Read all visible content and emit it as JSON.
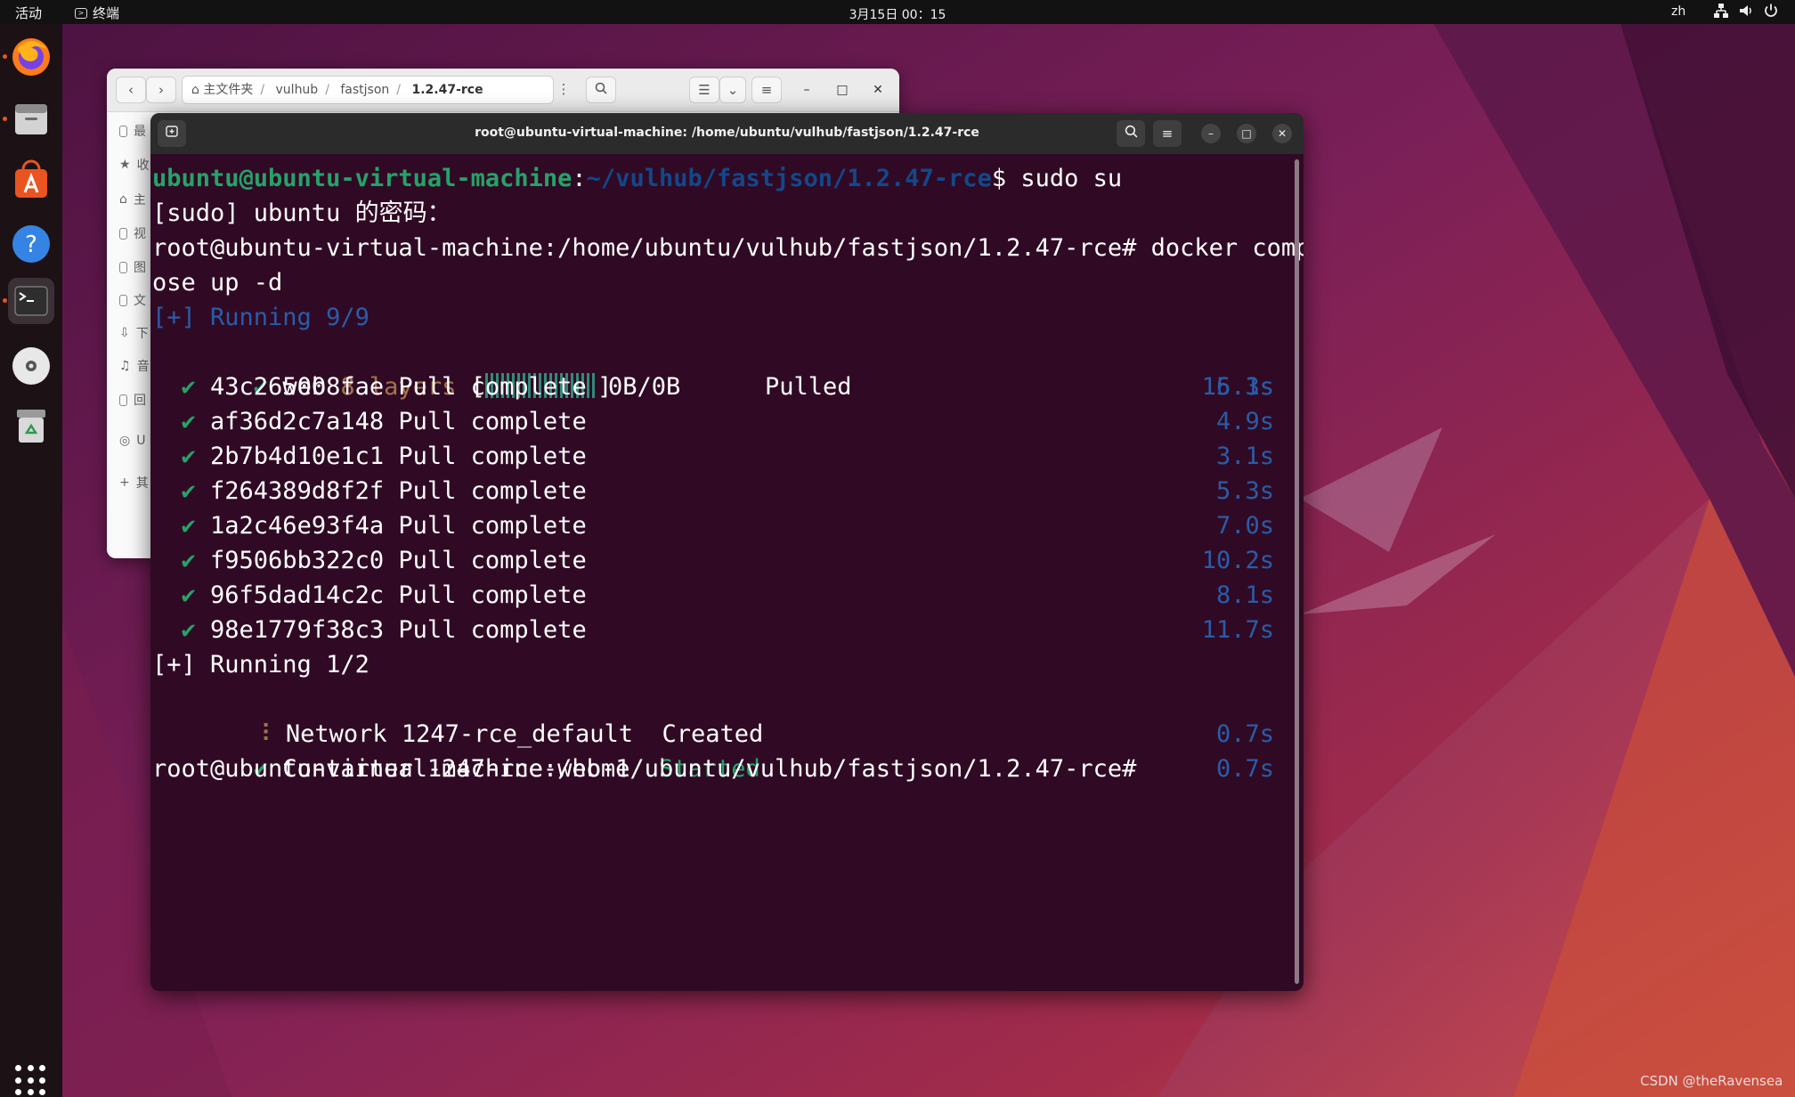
{
  "topbar": {
    "activities": "活动",
    "app_indicator": "终端",
    "clock": "3月15日  00：15",
    "lang": "zh"
  },
  "file_manager": {
    "path_home": "主文件夹",
    "path_1": "vulhub",
    "path_2": "fastjson",
    "path_3": "1.2.47-rce",
    "sidebar": [
      "最",
      "收",
      "主",
      "视",
      "图",
      "文",
      "下",
      "音",
      "回",
      "U",
      "其"
    ]
  },
  "terminal": {
    "title": "root@ubuntu-virtual-machine: /home/ubuntu/vulhub/fastjson/1.2.47-rce",
    "prompt_user": "ubuntu@ubuntu-virtual-machine",
    "prompt_colon": ":",
    "prompt_path": "~/vulhub/fastjson/1.2.47-rce",
    "prompt_cmd": "$ sudo su",
    "line_sudo": "[sudo] ubuntu 的密码：",
    "line_root_cmd": "root@ubuntu-virtual-machine:/home/ubuntu/vulhub/fastjson/1.2.47-rce# docker comp",
    "line_wrap": "ose up -d",
    "running_1": "[+] Running 9/9",
    "web_check": " ✔ ",
    "web_name": "web",
    "web_layers": " 8 layers ",
    "web_bracket_open": "[",
    "web_bracket_close": "]",
    "web_size": "0B/0B",
    "web_status": "Pulled",
    "web_time": "16.3s",
    "layers": [
      {
        "id": "43c265008fae",
        "status": "Pull complete",
        "time": "5.1s"
      },
      {
        "id": "af36d2c7a148",
        "status": "Pull complete",
        "time": "4.9s"
      },
      {
        "id": "2b7b4d10e1c1",
        "status": "Pull complete",
        "time": "3.1s"
      },
      {
        "id": "f264389d8f2f",
        "status": "Pull complete",
        "time": "5.3s"
      },
      {
        "id": "1a2c46e93f4a",
        "status": "Pull complete",
        "time": "7.0s"
      },
      {
        "id": "f9506bb322c0",
        "status": "Pull complete",
        "time": "10.2s"
      },
      {
        "id": "96f5dad14c2c",
        "status": "Pull complete",
        "time": "8.1s"
      },
      {
        "id": "98e1779f38c3",
        "status": "Pull complete",
        "time": "11.7s"
      }
    ],
    "running_2": "[+] Running 1/2",
    "network_mark": " ⠸ ",
    "network_name": "Network 1247-rce_default  ",
    "network_status": "Created",
    "network_time": "0.7s",
    "container_mark": " ✔ ",
    "container_name": "Container 1247-rce-web-1  ",
    "container_status": "Started",
    "container_time": "0.7s",
    "final_prompt": "root@ubuntu-virtual-machine:/home/ubuntu/vulhub/fastjson/1.2.47-rce#"
  },
  "watermark": "CSDN @theRavensea",
  "colors": {
    "terminal_bg": "#300a24",
    "prompt_green": "#26a269",
    "prompt_blue": "#12488b",
    "ubuntu_orange": "#e95420"
  }
}
